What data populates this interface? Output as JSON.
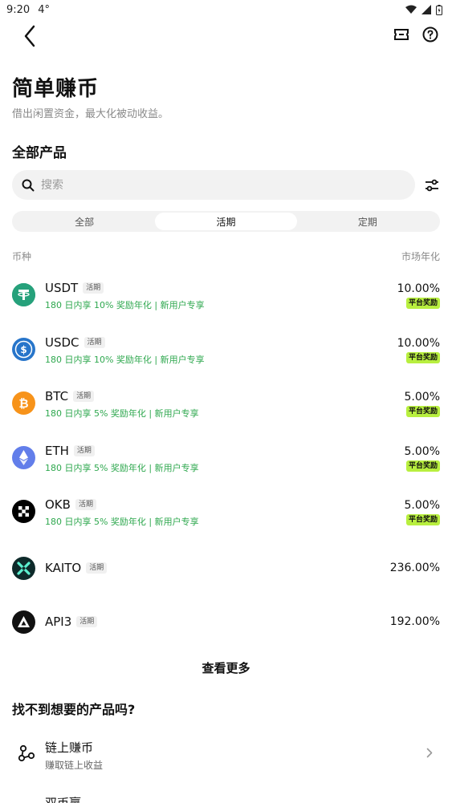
{
  "status_bar": {
    "time": "9:20",
    "temp": "4°"
  },
  "header": {
    "title": "简单赚币",
    "subtitle": "借出闲置资金，最大化被动收益。",
    "section": "全部产品"
  },
  "search": {
    "placeholder": "搜索",
    "value": ""
  },
  "tabs": [
    {
      "label": "全部",
      "active": false
    },
    {
      "label": "活期",
      "active": true
    },
    {
      "label": "定期",
      "active": false
    }
  ],
  "list_header": {
    "left": "币种",
    "right": "市场年化"
  },
  "coins": [
    {
      "symbol": "USDT",
      "type": "活期",
      "promo": "180 日内享 10% 奖励年化 | 新用户专享",
      "apy": "10.00%",
      "reward": "平台奖励",
      "icon": "usdt-icon",
      "color": "#26a17b"
    },
    {
      "symbol": "USDC",
      "type": "活期",
      "promo": "180 日内享 10% 奖励年化 | 新用户专享",
      "apy": "10.00%",
      "reward": "平台奖励",
      "icon": "usdc-icon",
      "color": "#2775ca"
    },
    {
      "symbol": "BTC",
      "type": "活期",
      "promo": "180 日内享 5% 奖励年化 | 新用户专享",
      "apy": "5.00%",
      "reward": "平台奖励",
      "icon": "btc-icon",
      "color": "#f7931a"
    },
    {
      "symbol": "ETH",
      "type": "活期",
      "promo": "180 日内享 5% 奖励年化 | 新用户专享",
      "apy": "5.00%",
      "reward": "平台奖励",
      "icon": "eth-icon",
      "color": "#627eea"
    },
    {
      "symbol": "OKB",
      "type": "活期",
      "promo": "180 日内享 5% 奖励年化 | 新用户专享",
      "apy": "5.00%",
      "reward": "平台奖励",
      "icon": "okb-icon",
      "color": "#000000"
    },
    {
      "symbol": "KAITO",
      "type": "活期",
      "promo": "",
      "apy": "236.00%",
      "reward": "",
      "icon": "kaito-icon",
      "color": "#0e2a2a"
    },
    {
      "symbol": "API3",
      "type": "活期",
      "promo": "",
      "apy": "192.00%",
      "reward": "",
      "icon": "api3-icon",
      "color": "#111111"
    }
  ],
  "more_label": "查看更多",
  "cant_find": "找不到想要的产品吗?",
  "onchain": {
    "title": "链上赚币",
    "subtitle": "赚取链上收益"
  },
  "clipped_text": "双币赢",
  "colors": {
    "promo_green": "#2fa84f",
    "reward_lime": "#b8ef3f"
  }
}
